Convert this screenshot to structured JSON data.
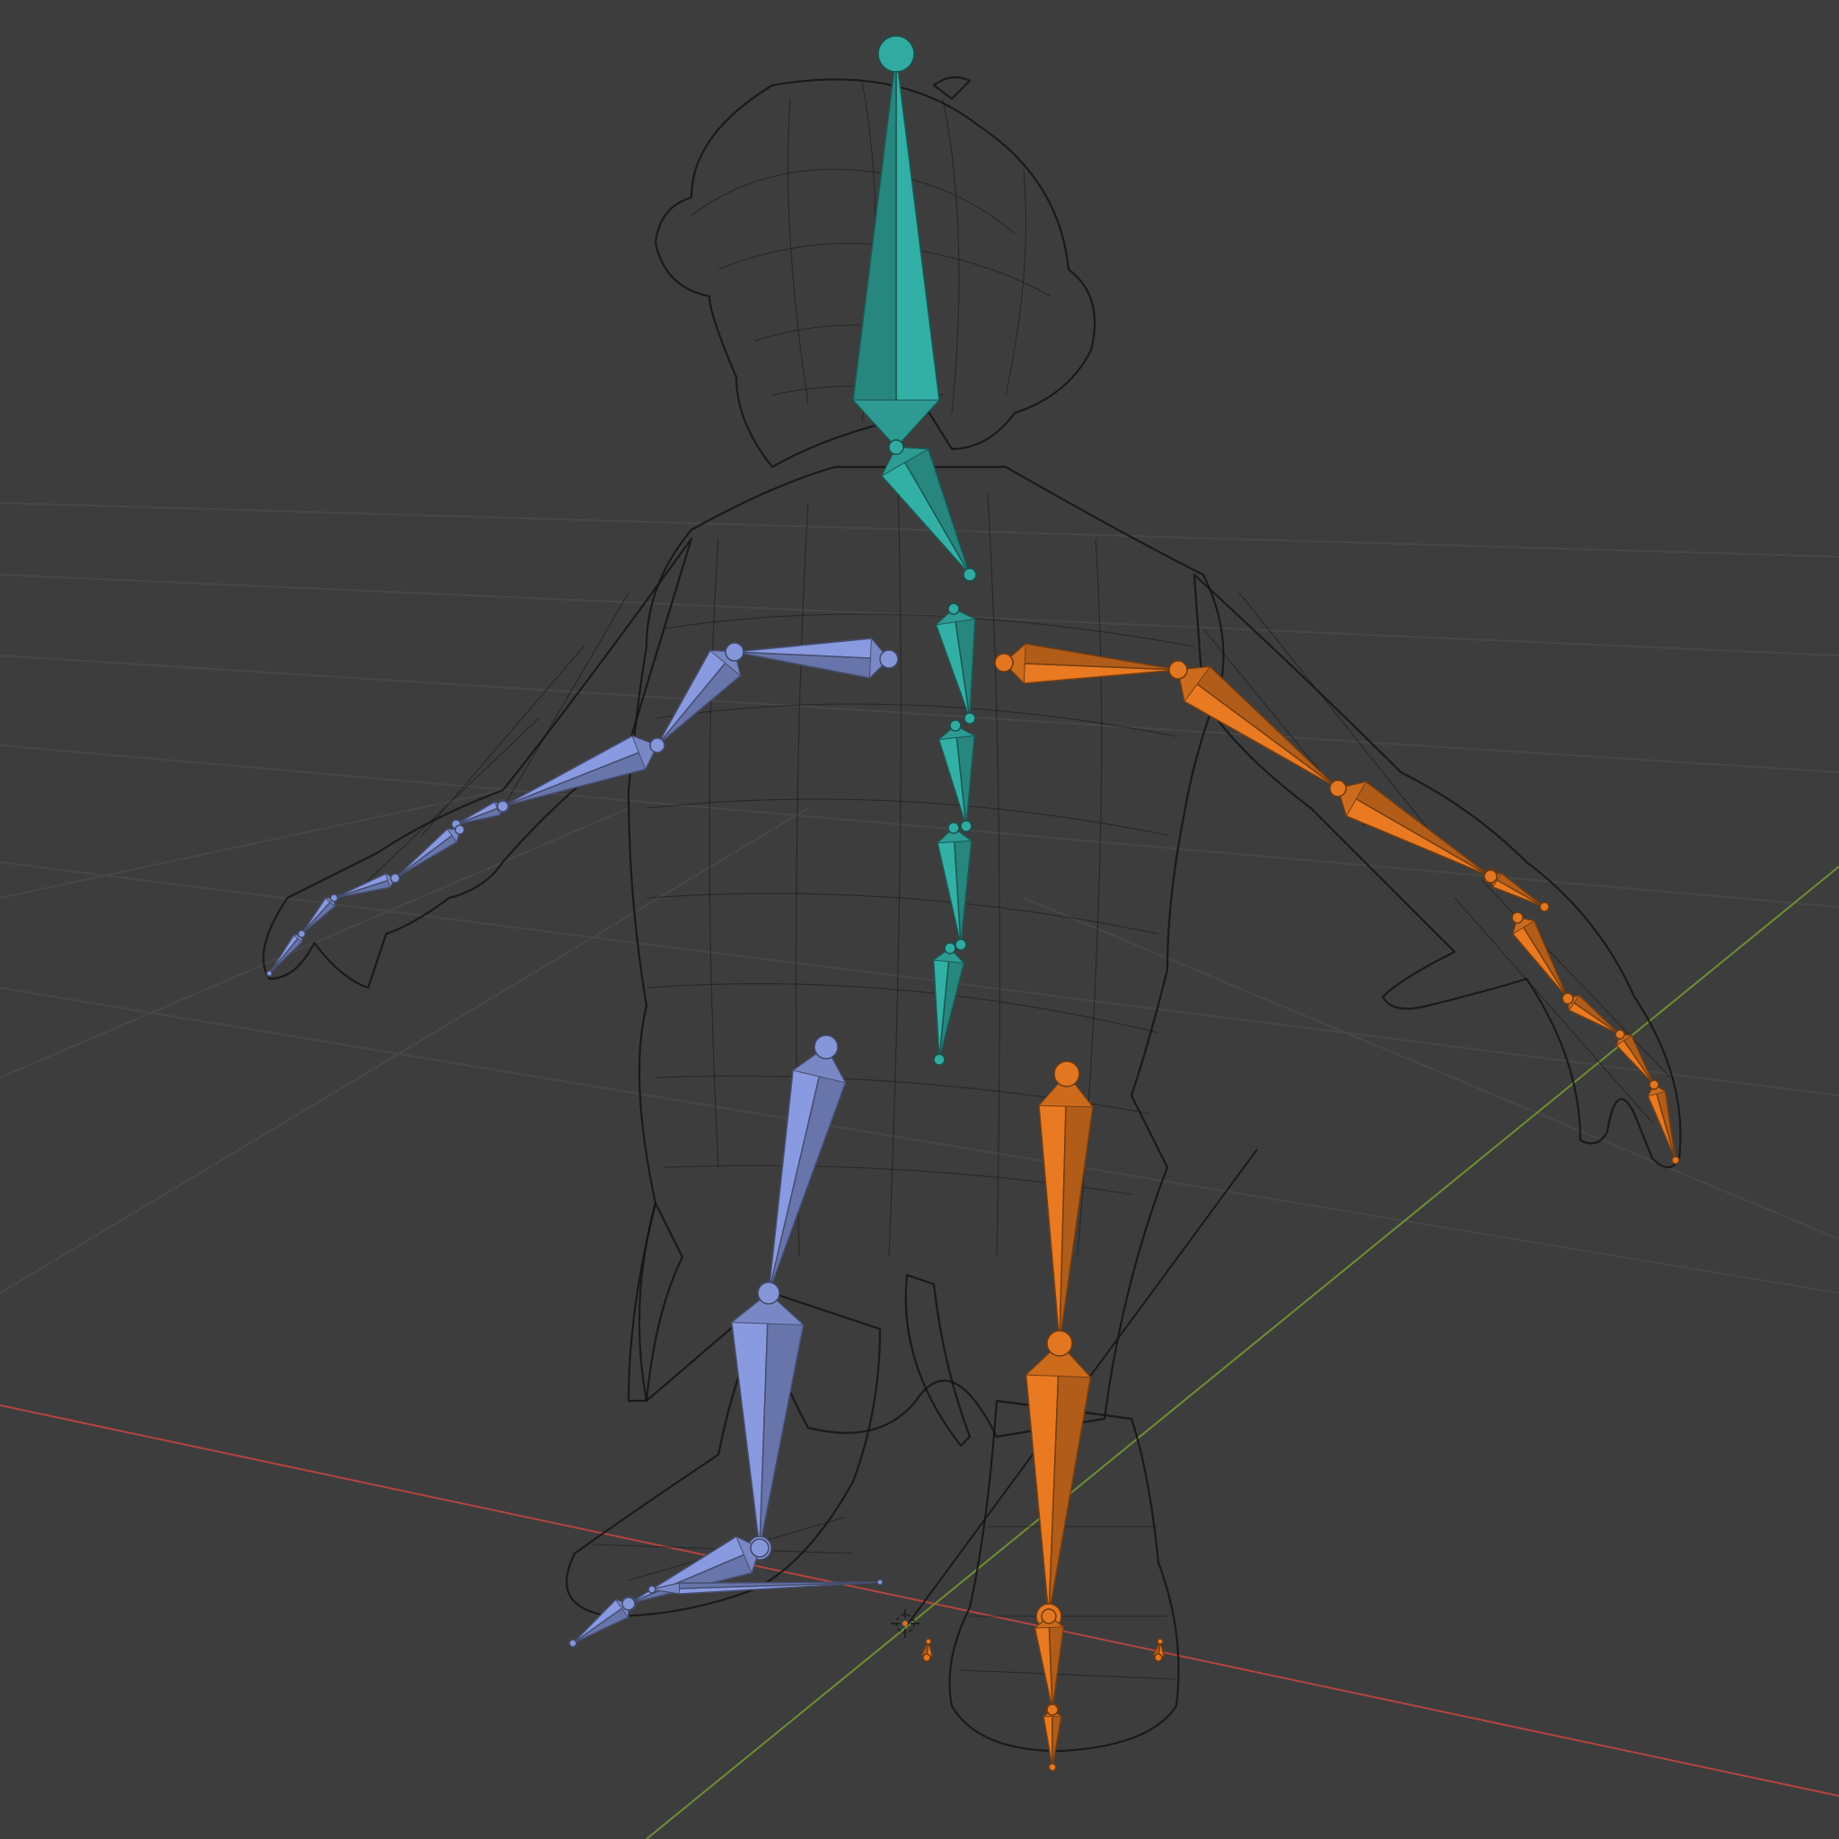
{
  "viewport": {
    "background": "#3d3d3d",
    "grid_color": "#484848",
    "x_axis_color": "#c0504d",
    "y_axis_color": "#7a9a3a"
  },
  "bone_groups": {
    "center": "#2fa39a",
    "left": "#7f8fcf",
    "right": "#d8711f"
  },
  "icons": {
    "origin": "3d-cursor-icon"
  }
}
